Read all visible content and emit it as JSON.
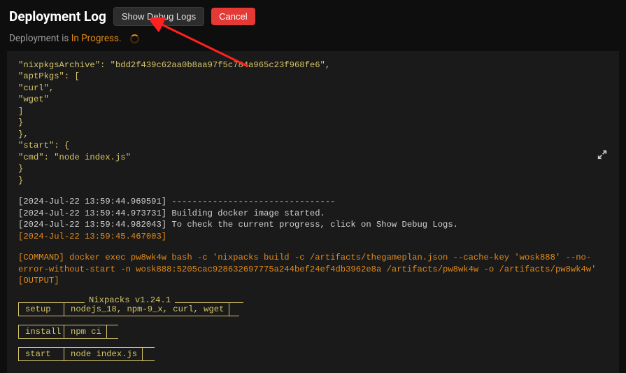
{
  "header": {
    "title": "Deployment Log",
    "debugBtn": "Show Debug Logs",
    "cancelBtn": "Cancel"
  },
  "status": {
    "prefix": "Deployment is ",
    "value": "In Progress."
  },
  "log": {
    "json_lines": [
      "\"nixpkgsArchive\": \"bdd2f439c62aa0b8aa97f5c784a965c23f968fe6\",",
      "\"aptPkgs\": [",
      "\"curl\",",
      "\"wget\"",
      "]",
      "}",
      "},",
      "\"start\": {",
      "\"cmd\": \"node index.js\"",
      "}",
      "}"
    ],
    "ts_lines": [
      {
        "ts": "[2024-Jul-22 13:59:44.969591]",
        "msg": " --------------------------------"
      },
      {
        "ts": "[2024-Jul-22 13:59:44.973731]",
        "msg": " Building docker image started."
      },
      {
        "ts": "[2024-Jul-22 13:59:44.982043]",
        "msg": " To check the current progress, click on Show Debug Logs."
      }
    ],
    "ts_only": "[2024-Jul-22 13:59:45.467003]",
    "command": "[COMMAND] docker exec pw8wk4w bash -c 'nixpacks build -c /artifacts/thegameplan.json --cache-key 'wosk888' --no-error-without-start -n wosk888:5205cac928632697775a244bef24ef4db3962e8a /artifacts/pw8wk4w -o /artifacts/pw8wk4w'",
    "output": "[OUTPUT]",
    "nixpacks": {
      "title": "Nixpacks v1.24.1",
      "rows": [
        {
          "step": "setup",
          "value": "nodejs_18, npm-9_x, curl, wget"
        },
        {
          "step": "install",
          "value": "npm ci"
        },
        {
          "step": "start",
          "value": "node index.js"
        }
      ]
    }
  }
}
